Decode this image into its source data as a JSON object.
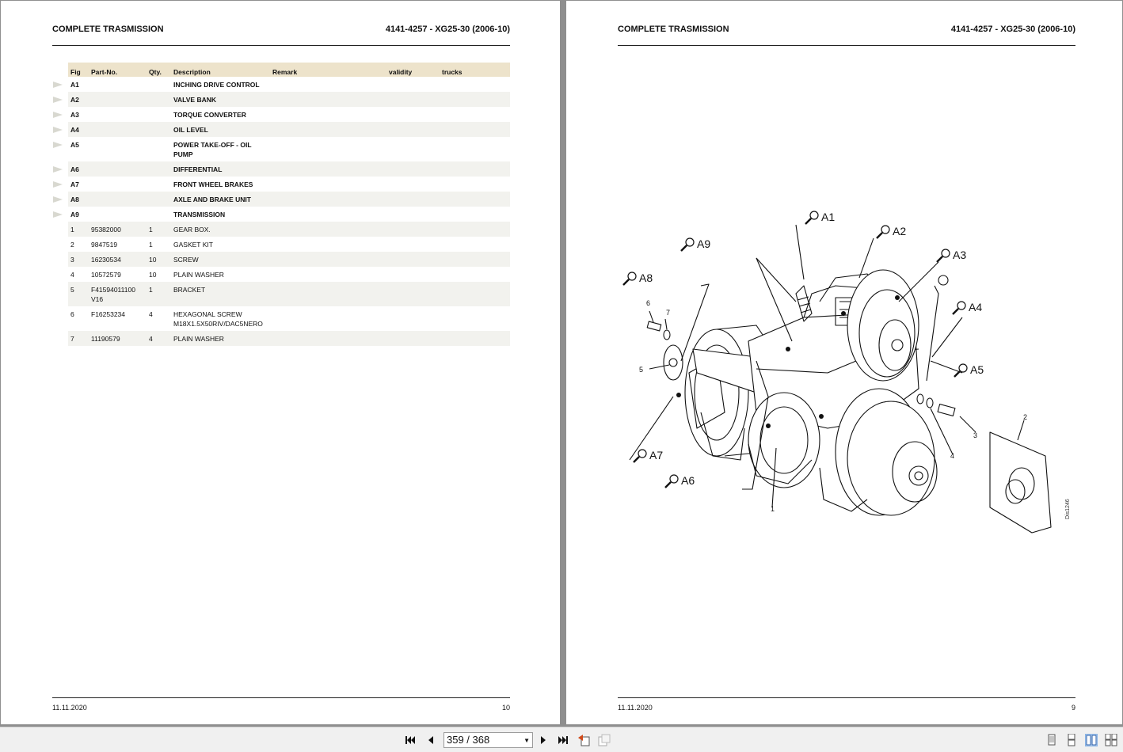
{
  "left_page": {
    "title": "COMPLETE TRASMISSION",
    "code": "4141-4257 - XG25-30 (2006-10)",
    "date": "11.11.2020",
    "page_number": "10",
    "columns": [
      "Fig",
      "Part-No.",
      "Qty.",
      "Description",
      "Remark",
      "validity",
      "trucks"
    ],
    "groups": [
      {
        "fig": "A1",
        "desc": "INCHING DRIVE CONTROL"
      },
      {
        "fig": "A2",
        "desc": "VALVE BANK"
      },
      {
        "fig": "A3",
        "desc": "TORQUE CONVERTER"
      },
      {
        "fig": "A4",
        "desc": "OIL LEVEL"
      },
      {
        "fig": "A5",
        "desc": "POWER TAKE-OFF - OIL",
        "desc2": "PUMP"
      },
      {
        "fig": "A6",
        "desc": "DIFFERENTIAL"
      },
      {
        "fig": "A7",
        "desc": "FRONT WHEEL BRAKES"
      },
      {
        "fig": "A8",
        "desc": "AXLE AND BRAKE UNIT"
      },
      {
        "fig": "A9",
        "desc": "TRANSMISSION"
      }
    ],
    "parts": [
      {
        "fig": "1",
        "part": "95382000",
        "qty": "1",
        "desc": "GEAR BOX."
      },
      {
        "fig": "2",
        "part": "9847519",
        "qty": "1",
        "desc": "GASKET KIT"
      },
      {
        "fig": "3",
        "part": "16230534",
        "qty": "10",
        "desc": "SCREW"
      },
      {
        "fig": "4",
        "part": "10572579",
        "qty": "10",
        "desc": "PLAIN WASHER"
      },
      {
        "fig": "5",
        "part": "F41594011100",
        "part2": "V16",
        "qty": "1",
        "desc": "BRACKET"
      },
      {
        "fig": "6",
        "part": "F16253234",
        "qty": "4",
        "desc": "HEXAGONAL SCREW",
        "desc2": "M18X1.5X50RIV/DAC5NERO"
      },
      {
        "fig": "7",
        "part": "11190579",
        "qty": "4",
        "desc": "PLAIN WASHER"
      }
    ]
  },
  "right_page": {
    "title": "COMPLETE TRASMISSION",
    "code": "4141-4257 - XG25-30 (2006-10)",
    "date": "11.11.2020",
    "page_number": "9",
    "diagram": {
      "callouts": [
        "A1",
        "A2",
        "A3",
        "A4",
        "A5",
        "A6",
        "A7",
        "A8",
        "A9"
      ],
      "item_labels": [
        "1",
        "2",
        "3",
        "4",
        "5",
        "6",
        "7"
      ],
      "drawing_id": "Dis1246"
    }
  },
  "toolbar": {
    "page_indicator": "359 / 368",
    "icons": [
      "first-page-icon",
      "prev-page-icon",
      "next-page-icon",
      "last-page-icon",
      "go-back-icon",
      "go-forward-icon",
      "single-page-view-icon",
      "continuous-view-icon",
      "two-page-view-icon",
      "two-page-continuous-view-icon"
    ]
  }
}
